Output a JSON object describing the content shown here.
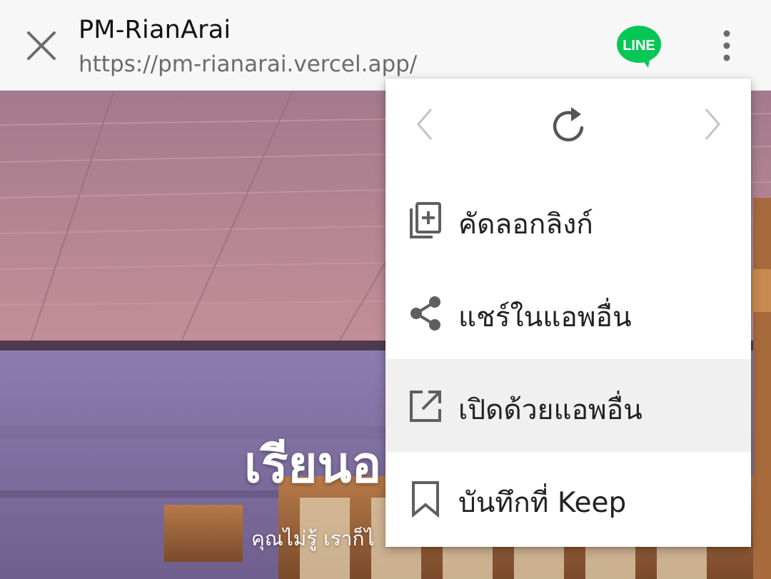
{
  "header": {
    "title": "PM-RianArai",
    "url": "https://pm-rianarai.vercel.app/",
    "line_badge": "LINE"
  },
  "page": {
    "hero_title": "เรียนอ",
    "hero_subtitle": "คุณไม่รู้ เราก็ไ"
  },
  "menu": {
    "nav": {
      "back_icon": "chevron-left-icon",
      "reload_icon": "reload-icon",
      "forward_icon": "chevron-right-icon"
    },
    "items": [
      {
        "label": "คัดลอกลิงก์",
        "icon": "copy-link-icon"
      },
      {
        "label": "แชร์ในแอพอื่น",
        "icon": "share-icon"
      },
      {
        "label": "เปิดด้วยแอพอื่น",
        "icon": "open-external-icon",
        "highlighted": true
      },
      {
        "label": "บันทึกที่ Keep",
        "icon": "bookmark-icon"
      }
    ]
  },
  "colors": {
    "toolbar_bg": "#f7f7f7",
    "line_green": "#06c755",
    "menu_highlight": "#f0f0f0",
    "icon_gray": "#5f5f5f"
  }
}
